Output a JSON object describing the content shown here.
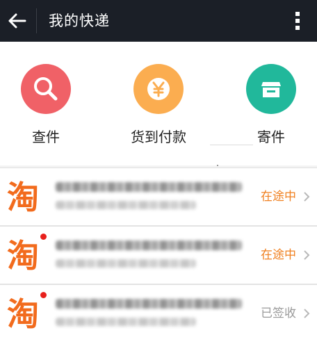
{
  "header": {
    "title": "我的快递",
    "back_icon": "arrow-left-icon",
    "more_icon": "more-vertical-icon"
  },
  "actions": [
    {
      "label": "查件",
      "icon": "search-icon",
      "color": "#f06167"
    },
    {
      "label": "货到付款",
      "icon": "yen-coin-icon",
      "color": "#fbad50"
    },
    {
      "label": "寄件",
      "icon": "package-box-icon",
      "color": "#21b89b"
    }
  ],
  "list": {
    "items": [
      {
        "logo": "淘",
        "status": "在途中",
        "status_color": "#f08020",
        "unread": false
      },
      {
        "logo": "淘",
        "status": "在途中",
        "status_color": "#f08020",
        "unread": true
      },
      {
        "logo": "淘",
        "status": "已签收",
        "status_color": "#999999",
        "unread": true
      }
    ]
  },
  "colors": {
    "topbar": "#1b1f27",
    "taobao_orange": "#f26b1d"
  }
}
